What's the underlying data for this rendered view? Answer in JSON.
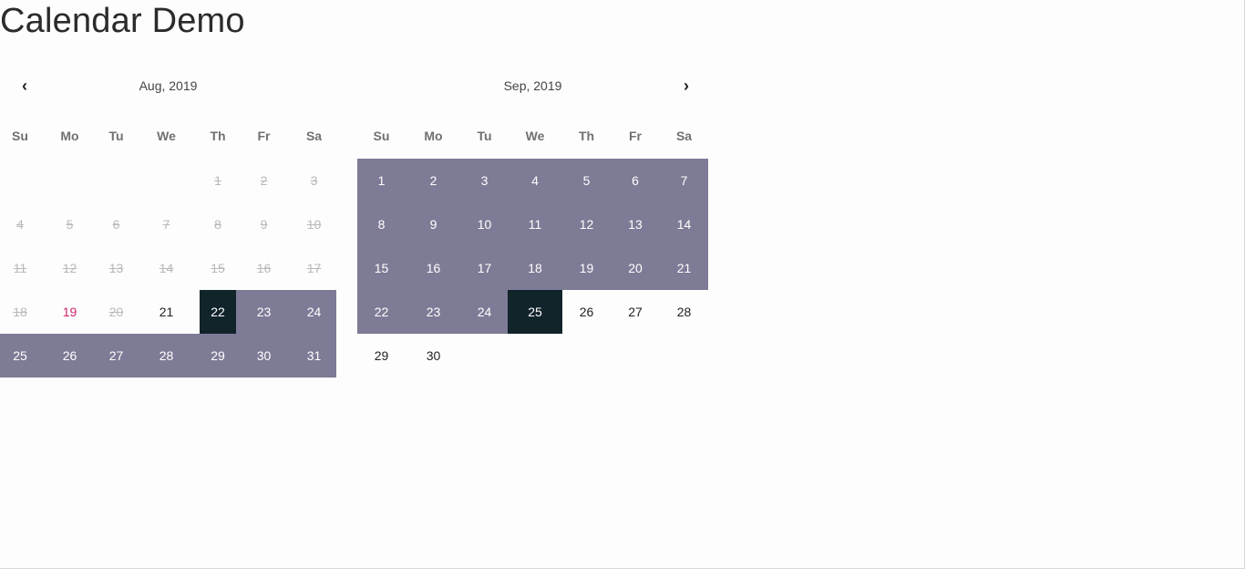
{
  "page": {
    "title": "Calendar Demo"
  },
  "nav": {
    "prev_icon": "chevron-left-icon",
    "next_icon": "chevron-right-icon",
    "prev_glyph": "‹",
    "next_glyph": "›"
  },
  "colors": {
    "range": "#7e7b96",
    "selected": "#11242a",
    "today": "#d0246a",
    "disabled": "#b9b9b9"
  },
  "weekdays": [
    "Su",
    "Mo",
    "Tu",
    "We",
    "Th",
    "Fr",
    "Sa"
  ],
  "months": [
    {
      "title": "Aug, 2019",
      "leading_blanks": 4,
      "days": [
        {
          "d": "1",
          "state": "disabled"
        },
        {
          "d": "2",
          "state": "disabled"
        },
        {
          "d": "3",
          "state": "disabled"
        },
        {
          "d": "4",
          "state": "disabled"
        },
        {
          "d": "5",
          "state": "disabled"
        },
        {
          "d": "6",
          "state": "disabled"
        },
        {
          "d": "7",
          "state": "disabled"
        },
        {
          "d": "8",
          "state": "disabled"
        },
        {
          "d": "9",
          "state": "disabled"
        },
        {
          "d": "10",
          "state": "disabled"
        },
        {
          "d": "11",
          "state": "disabled"
        },
        {
          "d": "12",
          "state": "disabled"
        },
        {
          "d": "13",
          "state": "disabled"
        },
        {
          "d": "14",
          "state": "disabled"
        },
        {
          "d": "15",
          "state": "disabled"
        },
        {
          "d": "16",
          "state": "disabled"
        },
        {
          "d": "17",
          "state": "disabled"
        },
        {
          "d": "18",
          "state": "disabled"
        },
        {
          "d": "19",
          "state": "today"
        },
        {
          "d": "20",
          "state": "disabled"
        },
        {
          "d": "21",
          "state": "normal"
        },
        {
          "d": "22",
          "state": "selected"
        },
        {
          "d": "23",
          "state": "range"
        },
        {
          "d": "24",
          "state": "range"
        },
        {
          "d": "25",
          "state": "range"
        },
        {
          "d": "26",
          "state": "range"
        },
        {
          "d": "27",
          "state": "range"
        },
        {
          "d": "28",
          "state": "range"
        },
        {
          "d": "29",
          "state": "range"
        },
        {
          "d": "30",
          "state": "range"
        },
        {
          "d": "31",
          "state": "range"
        }
      ]
    },
    {
      "title": "Sep, 2019",
      "leading_blanks": 0,
      "days": [
        {
          "d": "1",
          "state": "range"
        },
        {
          "d": "2",
          "state": "range"
        },
        {
          "d": "3",
          "state": "range"
        },
        {
          "d": "4",
          "state": "range"
        },
        {
          "d": "5",
          "state": "range"
        },
        {
          "d": "6",
          "state": "range"
        },
        {
          "d": "7",
          "state": "range"
        },
        {
          "d": "8",
          "state": "range"
        },
        {
          "d": "9",
          "state": "range"
        },
        {
          "d": "10",
          "state": "range"
        },
        {
          "d": "11",
          "state": "range"
        },
        {
          "d": "12",
          "state": "range"
        },
        {
          "d": "13",
          "state": "range"
        },
        {
          "d": "14",
          "state": "range"
        },
        {
          "d": "15",
          "state": "range"
        },
        {
          "d": "16",
          "state": "range"
        },
        {
          "d": "17",
          "state": "range"
        },
        {
          "d": "18",
          "state": "range"
        },
        {
          "d": "19",
          "state": "range"
        },
        {
          "d": "20",
          "state": "range"
        },
        {
          "d": "21",
          "state": "range"
        },
        {
          "d": "22",
          "state": "range"
        },
        {
          "d": "23",
          "state": "range"
        },
        {
          "d": "24",
          "state": "range"
        },
        {
          "d": "25",
          "state": "selected"
        },
        {
          "d": "26",
          "state": "normal"
        },
        {
          "d": "27",
          "state": "normal"
        },
        {
          "d": "28",
          "state": "normal"
        },
        {
          "d": "29",
          "state": "normal"
        },
        {
          "d": "30",
          "state": "normal"
        }
      ]
    }
  ]
}
